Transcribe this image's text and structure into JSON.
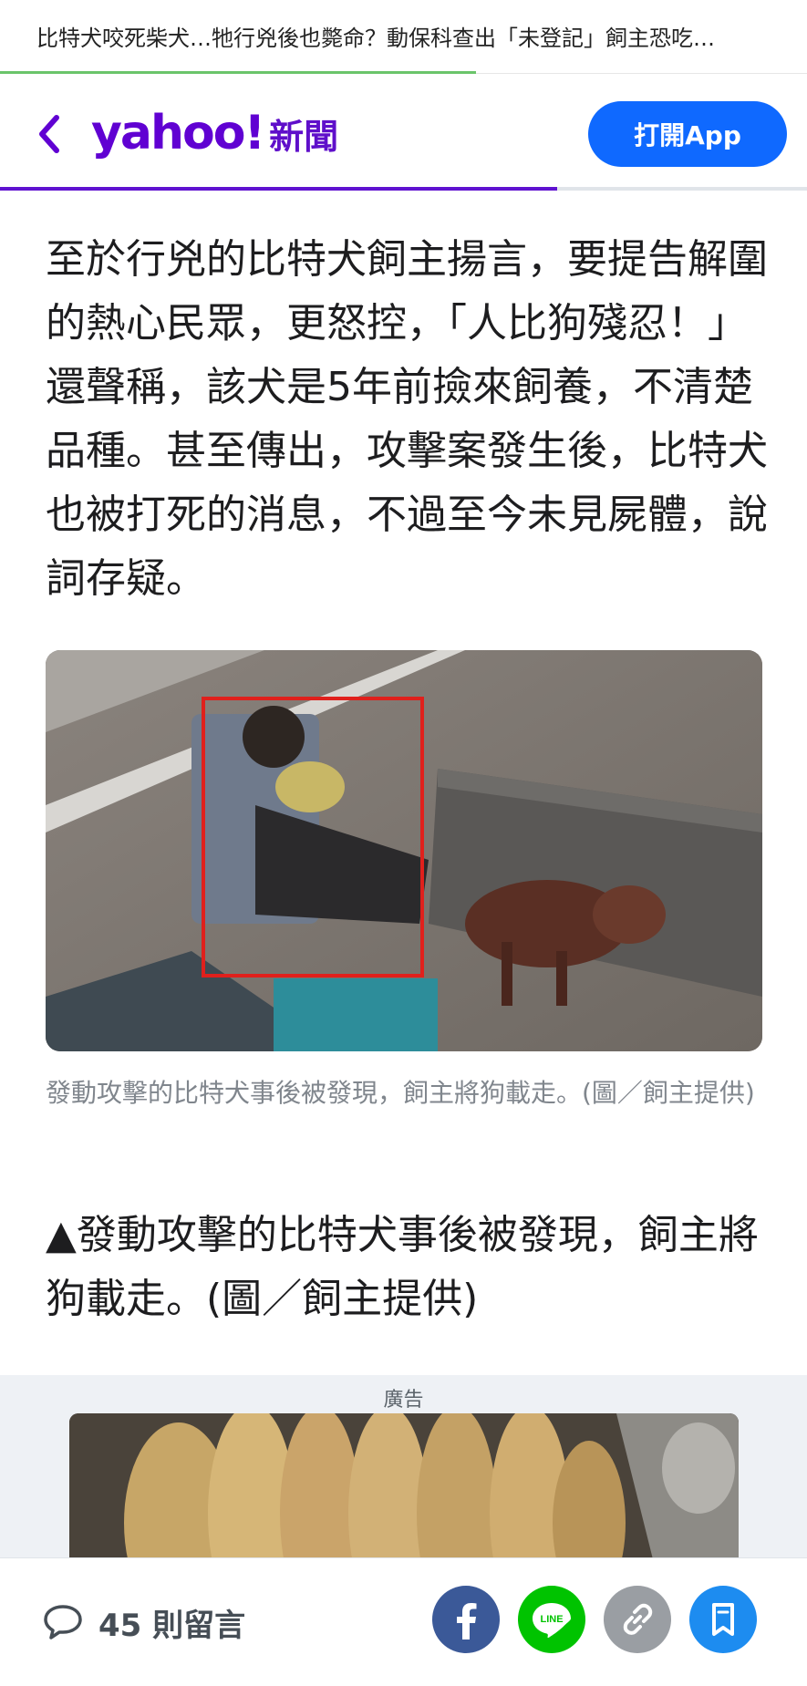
{
  "topbar": {
    "title": "比特犬咬死柴犬…牠行兇後也斃命？動保科查出「未登記」飼主恐吃…",
    "progress": 0.59,
    "progress_color": "#6ac46a"
  },
  "header": {
    "back_icon": "chevron-left-icon",
    "logo_text": "yahoo!",
    "logo_suffix": "新聞",
    "open_app_label": "打開App",
    "read_progress": 0.69,
    "brand_color": "#6001d2",
    "button_color": "#0f69ff"
  },
  "article": {
    "paragraph": "至於行兇的比特犬飼主揚言，要提告解圍的熱心民眾，更怒控，「人比狗殘忍！」還聲稱，該犬是5年前撿來飼養，不清楚品種。甚至傳出，攻擊案發生後，比特犬也被打死的消息，不過至今未見屍體，說詞存疑。",
    "image_caption": "發動攻擊的比特犬事後被發現，飼主將狗載走。(圖／飼主提供)",
    "subheading": "▲發動攻擊的比特犬事後被發現，飼主將狗載走。(圖／飼主提供)"
  },
  "ad": {
    "label": "廣告"
  },
  "bottom": {
    "comments_label": "45 則留言",
    "share_buttons": [
      {
        "icon": "facebook-icon",
        "color": "#3b5998"
      },
      {
        "icon": "line-icon",
        "color": "#00c300",
        "text": "LINE"
      },
      {
        "icon": "link-icon",
        "color": "#9a9ea3"
      },
      {
        "icon": "bookmark-icon",
        "color": "#1d8cf0"
      }
    ]
  }
}
